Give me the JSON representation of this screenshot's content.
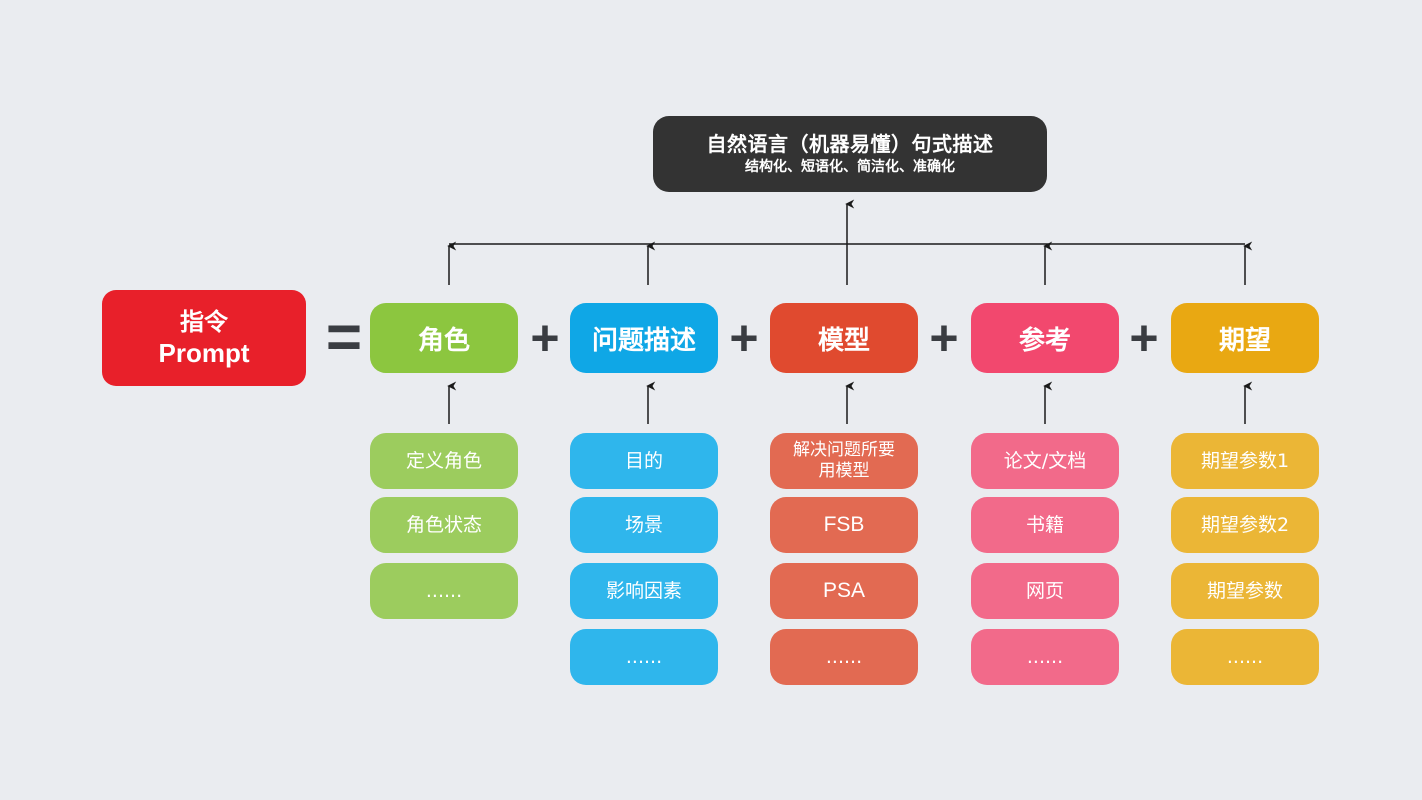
{
  "top_box": {
    "title": "自然语言（机器易懂）句式描述",
    "subtitle": "结构化、短语化、简洁化、准确化"
  },
  "prompt_box": {
    "line1": "指令",
    "line2": "Prompt"
  },
  "operators": {
    "equals": "=",
    "plus": "+"
  },
  "colors": {
    "background": "#eaecf0",
    "top_box": "#333333",
    "prompt_box": "#e8202a",
    "arrow": "#1a1a1a",
    "operator": "#3a3d42"
  },
  "columns": [
    {
      "title": "角色",
      "color": "#8cc63f",
      "sub_color": "#9ccc5e",
      "items": [
        "定义角色",
        "角色状态",
        "......"
      ]
    },
    {
      "title": "问题描述",
      "color": "#0fa7e6",
      "sub_color": "#2fb6ec",
      "items": [
        "目的",
        "场景",
        "影响因素",
        "......"
      ]
    },
    {
      "title": "模型",
      "color": "#e04a2f",
      "sub_color": "#e26a52",
      "items": [
        "解决问题所要用模型",
        "FSB",
        "PSA",
        "......"
      ]
    },
    {
      "title": "参考",
      "color": "#f2486e",
      "sub_color": "#f26a8a",
      "items": [
        "论文/文档",
        "书籍",
        "网页",
        "......"
      ]
    },
    {
      "title": "期望",
      "color": "#e9a812",
      "sub_color": "#ebb636",
      "items": [
        "期望参数1",
        "期望参数2",
        "期望参数",
        "......"
      ]
    }
  ]
}
